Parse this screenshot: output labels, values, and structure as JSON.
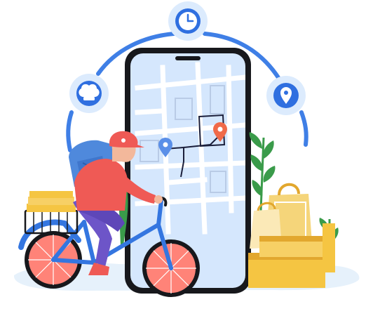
{
  "scene": {
    "subject": "food-delivery-courier-illustration",
    "icons": [
      "clock-icon",
      "chef-hat-icon",
      "location-pin-icon"
    ],
    "colors": {
      "ground": "#e6f1fb",
      "arc": "#3f7fe6",
      "icon_circle": "#dcebfd",
      "icon_blue": "#2f6fe0",
      "phone_body": "#17181c",
      "phone_screen": "#d5e7fd",
      "map_road": "#ffffff",
      "map_route": "#1b1f3b",
      "pin_red": "#f06a49",
      "pin_blue": "#5a8fe8",
      "jacket": "#ef5a55",
      "pants": "#6d55c8",
      "cap": "#ef5a55",
      "skin": "#f3b89b",
      "backpack": "#4f89dc",
      "bike_frame": "#3476e0",
      "wheel_fill": "#ff8378",
      "box": "#f5c542",
      "box_dark": "#e2a72e",
      "bag": "#f5d57a",
      "plant": "#3a9b4a"
    }
  }
}
